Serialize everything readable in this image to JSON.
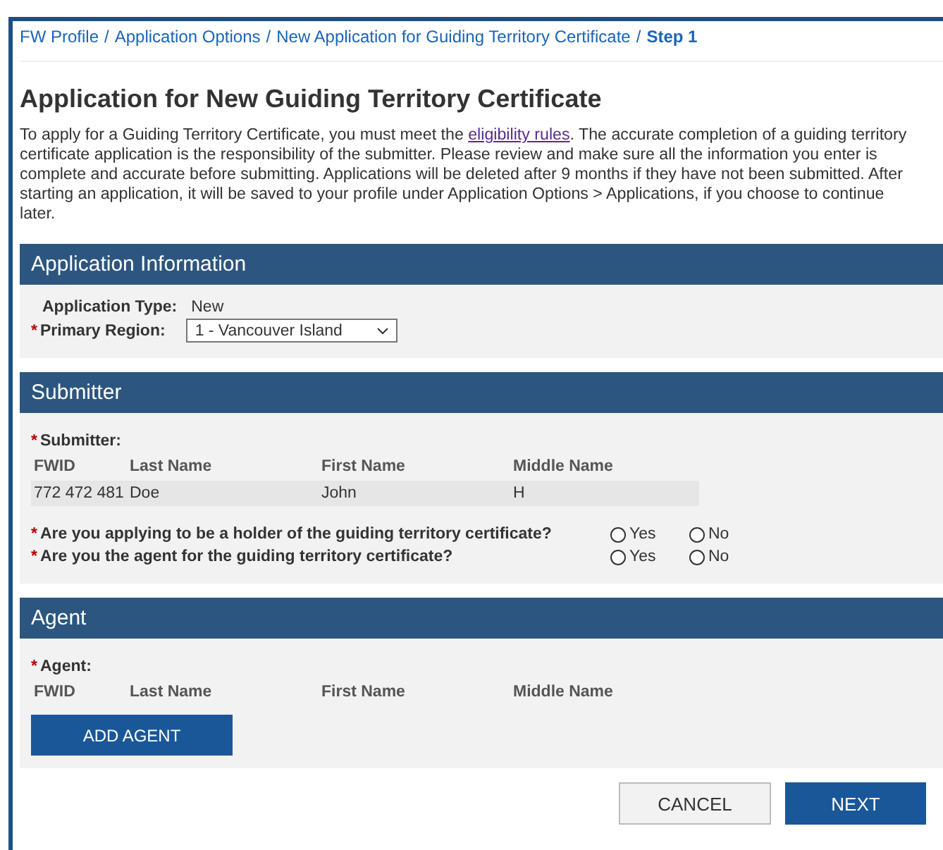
{
  "breadcrumb": {
    "links": [
      "FW Profile",
      "Application Options",
      "New Application for Guiding Territory Certificate"
    ],
    "separator": "/",
    "current": "Step 1"
  },
  "title": "Application for New Guiding Territory Certificate",
  "intro": {
    "before": "To apply for a Guiding Territory Certificate, you must meet the ",
    "link": "eligibility rules",
    "after": ". The accurate completion of a guiding territory certificate application is the responsibility of the submitter. Please review and make sure all the information you enter is complete and accurate before submitting. Applications will be deleted after 9 months if they have not been submitted. After starting an application, it will be saved to your profile under Application Options > Applications, if you choose to continue later."
  },
  "application_information": {
    "heading": "Application Information",
    "type_label": "Application Type:",
    "type_value": "New",
    "region": {
      "marker": "*",
      "label": "Primary Region:",
      "value": "1 - Vancouver Island"
    }
  },
  "submitter": {
    "heading": "Submitter",
    "label": {
      "marker": "*",
      "text": "Submitter:"
    },
    "columns": [
      "FWID",
      "Last Name",
      "First Name",
      "Middle Name"
    ],
    "rows": [
      [
        "772 472 481",
        "Doe",
        "John",
        "H"
      ]
    ],
    "questions": [
      {
        "marker": "*",
        "text": "Are you applying to be a holder of the guiding territory certificate?",
        "options": [
          {
            "label": "Yes",
            "selected": false
          },
          {
            "label": "No",
            "selected": false
          }
        ]
      },
      {
        "marker": "*",
        "text": "Are you the agent for the guiding territory certificate?",
        "options": [
          {
            "label": "Yes",
            "selected": false
          },
          {
            "label": "No",
            "selected": false
          }
        ]
      }
    ]
  },
  "agent": {
    "heading": "Agent",
    "label": {
      "marker": "*",
      "text": "Agent:"
    },
    "columns": [
      "FWID",
      "Last Name",
      "First Name",
      "Middle Name"
    ],
    "add_button": "ADD AGENT"
  },
  "buttons": [
    {
      "label": "CANCEL",
      "kind": "secondary"
    },
    {
      "label": "NEXT",
      "kind": "primary"
    }
  ]
}
